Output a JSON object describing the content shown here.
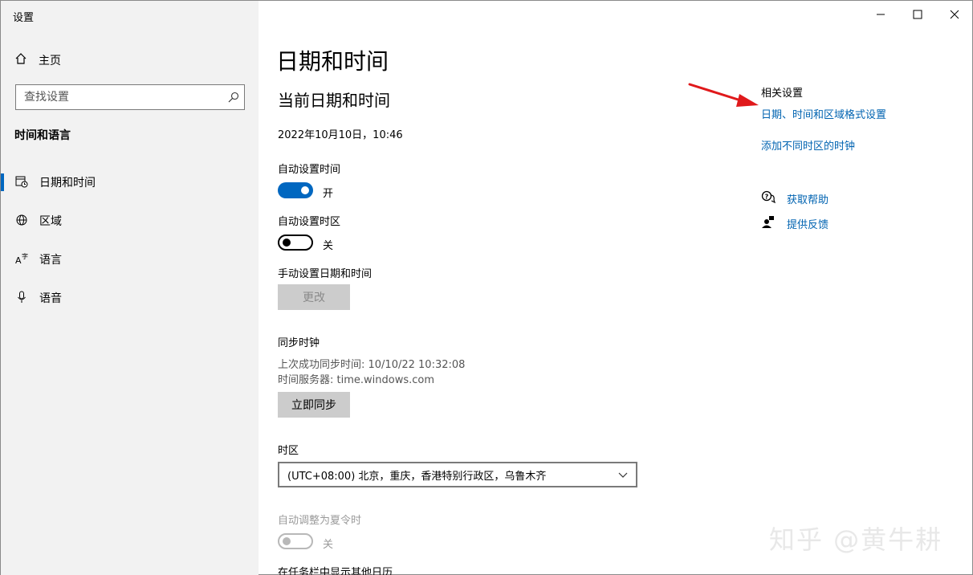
{
  "window": {
    "title": "设置",
    "controls": {
      "minimize": "—",
      "maximize": "☐",
      "close": "✕"
    }
  },
  "sidebar": {
    "home_label": "主页",
    "search_placeholder": "查找设置",
    "section_title": "时间和语言",
    "items": [
      {
        "label": "日期和时间",
        "icon": "calendar-clock-icon",
        "active": true
      },
      {
        "label": "区域",
        "icon": "globe-icon",
        "active": false
      },
      {
        "label": "语言",
        "icon": "language-icon",
        "active": false
      },
      {
        "label": "语音",
        "icon": "microphone-icon",
        "active": false
      }
    ]
  },
  "main": {
    "page_title": "日期和时间",
    "current_section_title": "当前日期和时间",
    "current_datetime": "2022年10月10日，10:46",
    "auto_time": {
      "label": "自动设置时间",
      "state_label": "开",
      "on": true
    },
    "auto_timezone": {
      "label": "自动设置时区",
      "state_label": "关",
      "on": false
    },
    "manual": {
      "label": "手动设置日期和时间",
      "button": "更改"
    },
    "sync": {
      "title": "同步时钟",
      "last_sync": "上次成功同步时间: 10/10/22 10:32:08",
      "server": "时间服务器: time.windows.com",
      "button": "立即同步"
    },
    "timezone": {
      "label": "时区",
      "value": "(UTC+08:00) 北京，重庆，香港特别行政区，乌鲁木齐"
    },
    "dst": {
      "label": "自动调整为夏令时",
      "state_label": "关",
      "on": false
    },
    "other_calendars_label": "在任务栏中显示其他日历"
  },
  "related": {
    "title": "相关设置",
    "links": [
      "日期、时间和区域格式设置",
      "添加不同时区的时钟"
    ],
    "help": "获取帮助",
    "feedback": "提供反馈"
  },
  "watermark": "知乎 @黄牛耕",
  "colors": {
    "accent": "#0067c0",
    "link": "#0063b1",
    "sidebar_bg": "#f2f2f2",
    "arrow": "#e0191b"
  }
}
